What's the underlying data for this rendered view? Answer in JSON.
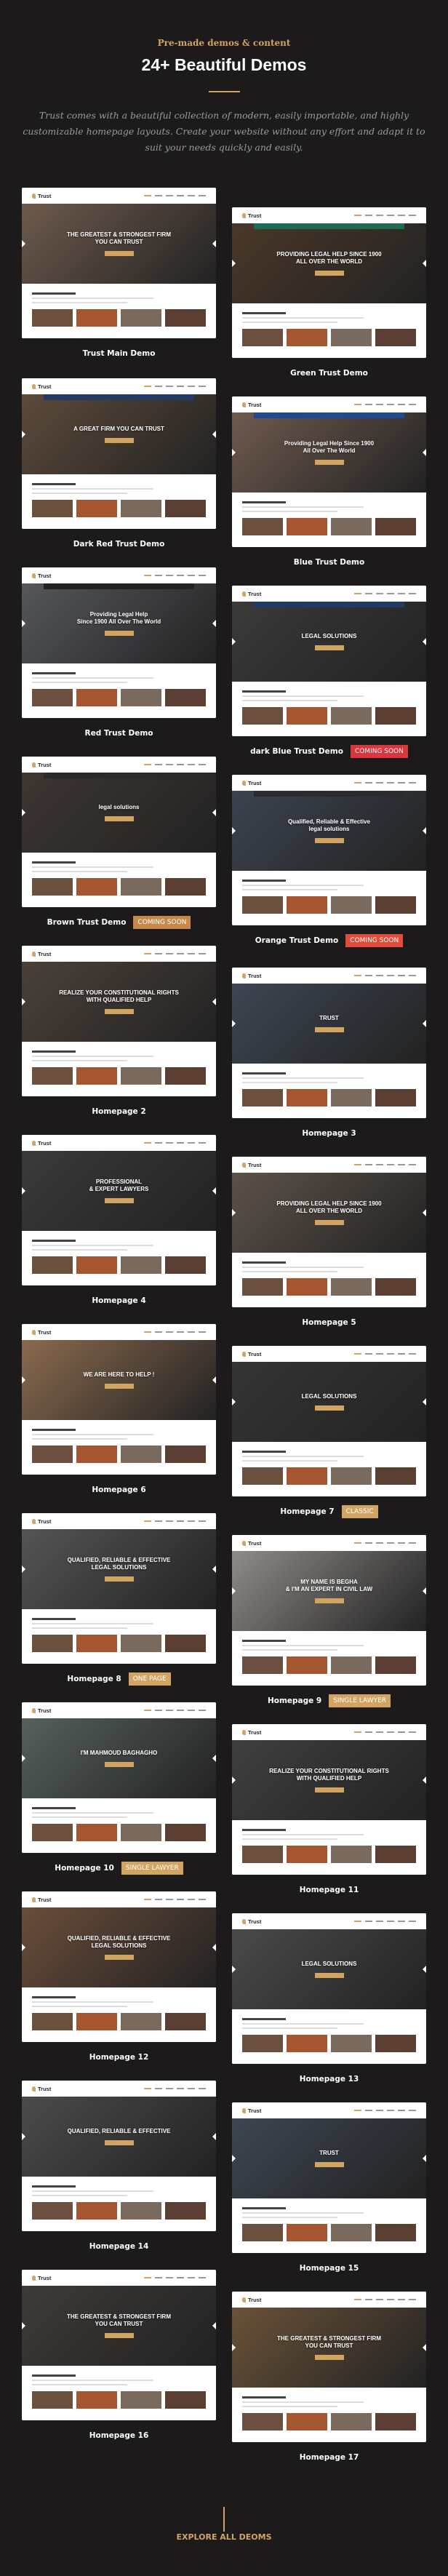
{
  "header": {
    "kicker": "Pre-made demos & content",
    "title": "24+ Beautiful Demos",
    "intro": "Trust comes with a beautiful collection of modern, easily importable, and highly customizable homepage layouts. Create your website without any effort and adapt it to suit your needs quickly and easily."
  },
  "colors": {
    "accent": "#d2a461",
    "background": "#1c1a1b",
    "coming_soon_red": "#d9363e",
    "coming_soon_brown": "#c8884a",
    "coming_soon_orange": "#e24c3c"
  },
  "demos": [
    {
      "label": "Trust Main Demo",
      "badge": "",
      "headline": "THE GREATEST & STRONGEST FIRM\nYOU CAN TRUST",
      "hero": "#6e5a4c",
      "nav": ""
    },
    {
      "label": "Green Trust Demo",
      "badge": "",
      "headline": "PROVIDING LEGAL HELP SINCE 1900\nALL OVER THE WORLD",
      "hero": "#4a3728",
      "nav": "#1f6a52"
    },
    {
      "label": "Dark Red Trust Demo",
      "badge": "",
      "headline": "A GREAT FIRM YOU CAN TRUST",
      "hero": "#5d4a3a",
      "nav": "#233a63"
    },
    {
      "label": "Blue Trust Demo",
      "badge": "",
      "headline": "Providing Legal Help Since 1900\nAll Over The World",
      "hero": "#6f5a4e",
      "nav": "#1e4a8f"
    },
    {
      "label": "Red Trust Demo",
      "badge": "",
      "headline": "Providing Legal Help\nSince 1900 All Over The World",
      "hero": "#55575c",
      "nav": "#222222"
    },
    {
      "label": "dark Blue Trust Demo",
      "badge": "COMING SOON",
      "badge_color": "#d9363e",
      "headline": "LEGAL SOLUTIONS",
      "hero": "#3a3a3a",
      "nav": "#233a63"
    },
    {
      "label": "Brown Trust Demo",
      "badge": "COMING SOON",
      "badge_color": "#c8884a",
      "headline": "legal solutions",
      "hero": "#3d3632",
      "nav": "#2a2a2a"
    },
    {
      "label": "Orange Trust Demo",
      "badge": "COMING SOON",
      "badge_color": "#e24c3c",
      "headline": "Qualified, Reliable & Effective\nlegal solutions",
      "hero": "#3c4350",
      "nav": "#2b2b2b"
    },
    {
      "label": "Homepage 2",
      "badge": "",
      "headline": "REALIZE YOUR CONSTITUTIONAL RIGHTS\nWITH QUALIFIED HELP",
      "hero": "#4a4039",
      "nav": ""
    },
    {
      "label": "Homepage 3",
      "badge": "",
      "headline": "TRUST",
      "hero": "#3d4652",
      "nav": ""
    },
    {
      "label": "Homepage 4",
      "badge": "",
      "headline": "PROFESSIONAL\n& EXPERT LAWYERS",
      "hero": "#3a3a3a",
      "nav": ""
    },
    {
      "label": "Homepage 5",
      "badge": "",
      "headline": "PROVIDING LEGAL HELP SINCE 1900\nALL OVER THE WORLD",
      "hero": "#5d5249",
      "nav": ""
    },
    {
      "label": "Homepage 6",
      "badge": "",
      "headline": "WE ARE HERE TO HELP !",
      "hero": "#8a6a4e",
      "nav": ""
    },
    {
      "label": "Homepage 7",
      "badge": "CLASSIC",
      "badge_color": "#d2a461",
      "headline": "LEGAL SOLUTIONS",
      "hero": "#353535",
      "nav": ""
    },
    {
      "label": "Homepage 8",
      "badge": "ONE PAGE",
      "badge_color": "#d2a461",
      "headline": "QUALIFIED, RELIABLE & EFFECTIVE\nLEGAL SOLUTIONS",
      "hero": "#555555",
      "nav": ""
    },
    {
      "label": "Homepage 9",
      "badge": "SINGLE LAWYER",
      "badge_color": "#d2a461",
      "headline": "MY NAME IS BEGHA\n& I'M AN EXPERT IN CIVIL LAW",
      "hero": "#8f8b87",
      "nav": ""
    },
    {
      "label": "Homepage 10",
      "badge": "SINGLE LAWYER",
      "badge_color": "#d2a461",
      "headline": "I'M MAHMOUD BAGHAGHO",
      "hero": "#56605d",
      "nav": ""
    },
    {
      "label": "Homepage 11",
      "badge": "",
      "headline": "REALIZE YOUR CONSTITUTIONAL RIGHTS\nWITH QUALIFIED HELP",
      "hero": "#3f3f3f",
      "nav": ""
    },
    {
      "label": "Homepage 12",
      "badge": "",
      "headline": "QUALIFIED, RELIABLE & EFFECTIVE\nLEGAL SOLUTIONS",
      "hero": "#6b4d3a",
      "nav": ""
    },
    {
      "label": "Homepage 13",
      "badge": "",
      "headline": "LEGAL SOLUTIONS",
      "hero": "#4a4a4a",
      "nav": ""
    },
    {
      "label": "Homepage 14",
      "badge": "",
      "headline": "QUALIFIED, RELIABLE & EFFECTIVE",
      "hero": "#4b4b4b",
      "nav": ""
    },
    {
      "label": "Homepage 15",
      "badge": "",
      "headline": "TRUST",
      "hero": "#3d4652",
      "nav": ""
    },
    {
      "label": "Homepage 16",
      "badge": "",
      "headline": "THE GREATEST & STRONGEST FIRM\nYOU CAN TRUST",
      "hero": "#3e3a37",
      "nav": ""
    },
    {
      "label": "Homepage 17",
      "badge": "",
      "headline": "THE GREATEST & STRONGEST FIRM\nYOU CAN TRUST",
      "hero": "#6a5238",
      "nav": ""
    }
  ],
  "footer": {
    "cta": "EXPLORE ALL DEOMS"
  }
}
